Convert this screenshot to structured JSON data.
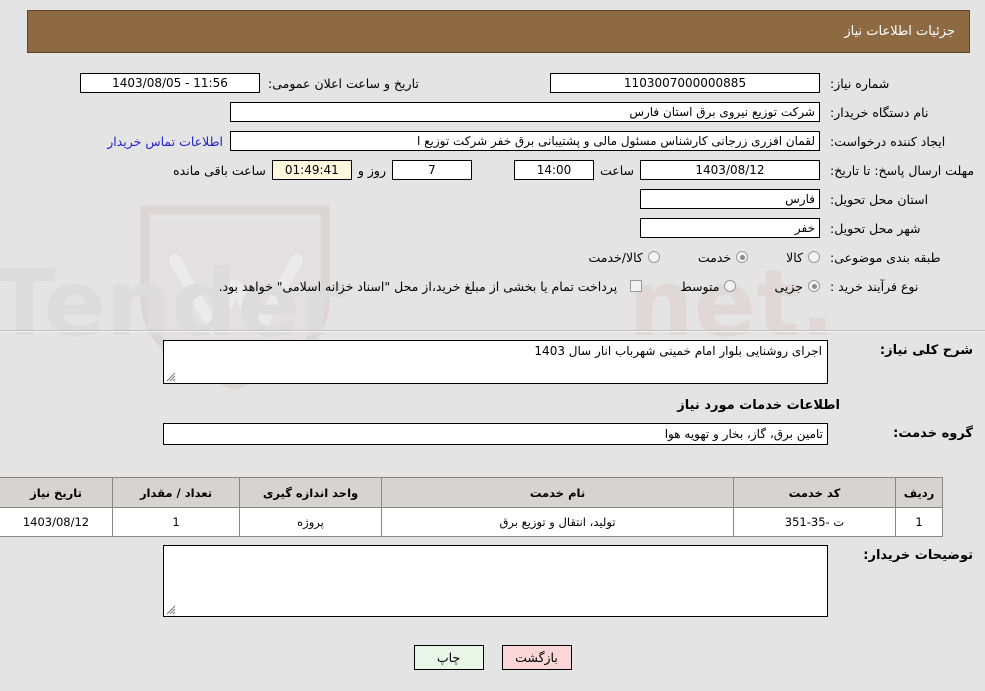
{
  "header": {
    "title": "جزئیات اطلاعات نیاز"
  },
  "info": {
    "need_number_label": "شماره نیاز:",
    "need_number": "1103007000000885",
    "public_announce_label": "تاریخ و ساعت اعلان عمومی:",
    "public_announce_value": "11:56 - 1403/08/05",
    "buyer_org_label": "نام دستگاه خریدار:",
    "buyer_org": "شرکت توزیع نیروی برق استان فارس",
    "creator_label": "ایجاد کننده درخواست:",
    "creator": "لقمان افزری زرجانی کارشناس مسئول مالی و پشتیبانی برق خفر شرکت توزیع ا",
    "contact_link": "اطلاعات تماس خریدار",
    "deadline_label": "مهلت ارسال پاسخ: تا تاریخ:",
    "deadline_date": "1403/08/12",
    "hour_label": "ساعت",
    "deadline_time": "14:00",
    "days_value": "7",
    "days_label": "روز و",
    "countdown": "01:49:41",
    "remaining_label": "ساعت باقی مانده",
    "province_label": "استان محل تحویل:",
    "province": "فارس",
    "city_label": "شهر محل تحویل:",
    "city": "خفر",
    "classification_label": "طبقه بندی موضوعی:",
    "classification_options": [
      {
        "label": "کالا",
        "selected": false
      },
      {
        "label": "خدمت",
        "selected": true
      },
      {
        "label": "کالا/خدمت",
        "selected": false
      }
    ],
    "process_label": "نوع فرآیند خرید :",
    "process_options": [
      {
        "label": "جزیی",
        "selected": true
      },
      {
        "label": "متوسط",
        "selected": false
      }
    ],
    "treasury_checkbox_text": "پرداخت تمام یا بخشی از مبلغ خرید،از محل \"اسناد خزانه اسلامی\" خواهد بود."
  },
  "mid": {
    "general_desc_label": "شرح کلی نیاز:",
    "general_desc_value": "اجرای روشنایی بلوار امام خمینی شهرباب انار سال 1403",
    "services_section_title": "اطلاعات خدمات مورد نیاز",
    "service_group_label": "گروه خدمت:",
    "service_group_value": "تامین برق، گاز، بخار و تهویه هوا",
    "buyer_notes_label": "توضیحات خریدار:",
    "buyer_notes_value": ""
  },
  "table": {
    "columns": [
      "ردیف",
      "کد خدمت",
      "نام خدمت",
      "واحد اندازه گیری",
      "تعداد / مقدار",
      "تاریخ نیاز"
    ],
    "rows": [
      {
        "row_no": "1",
        "service_code": "ت -35-351",
        "service_name": "تولید، انتقال و توزیع برق",
        "unit": "پروژه",
        "quantity": "1",
        "need_date": "1403/08/12"
      }
    ]
  },
  "buttons": {
    "print": "چاپ",
    "back": "بازگشت"
  },
  "colors": {
    "header_bg": "#8d6a42",
    "page_bg": "#e4e4e4",
    "link": "#2222cc",
    "timer_bg": "#fdf7dd",
    "print_bg": "#e8f6e8",
    "back_bg": "#fbd6d6"
  }
}
